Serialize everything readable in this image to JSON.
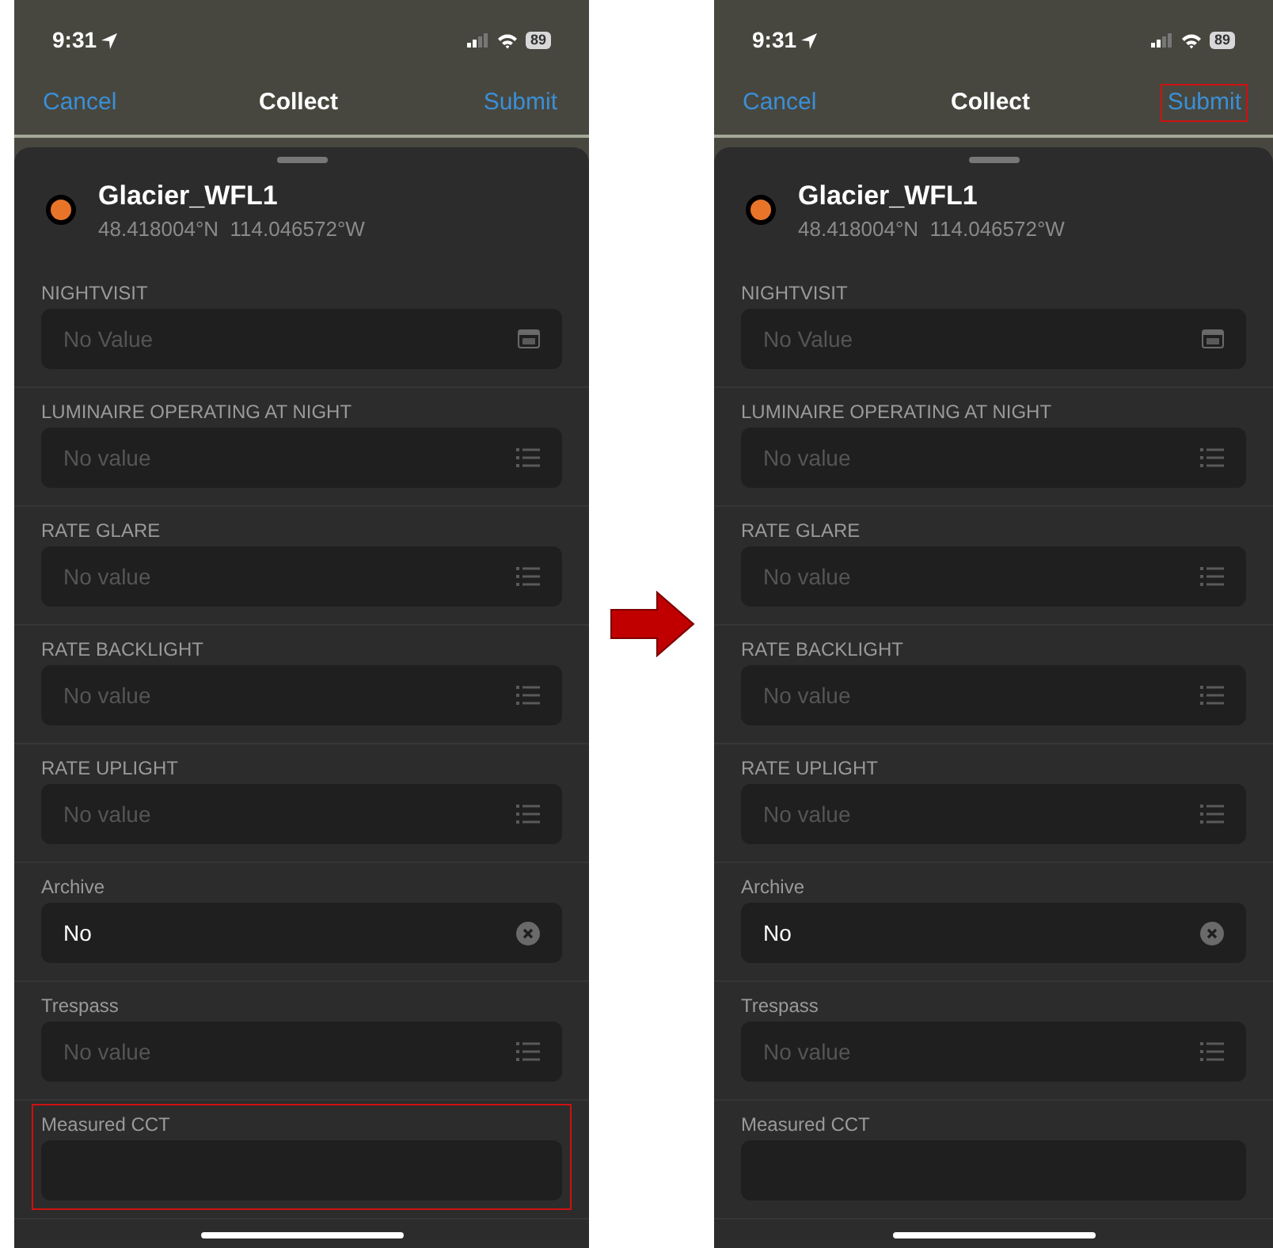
{
  "phones": [
    {
      "status": {
        "time": "9:31",
        "battery": "89"
      },
      "nav": {
        "cancel": "Cancel",
        "title": "Collect",
        "submit": "Submit",
        "submit_highlighted": false
      },
      "feature": {
        "name": "Glacier_WFL1",
        "coords": "48.418004°N  114.046572°W",
        "color": "#e8742a"
      },
      "fields": [
        {
          "label": "NIGHTVISIT",
          "kind": "date",
          "placeholder": "No Value",
          "highlighted": false
        },
        {
          "label": "LUMINAIRE OPERATING AT NIGHT",
          "kind": "list",
          "placeholder": "No value",
          "highlighted": false
        },
        {
          "label": "RATE GLARE",
          "kind": "list",
          "placeholder": "No value",
          "highlighted": false
        },
        {
          "label": "RATE BACKLIGHT",
          "kind": "list",
          "placeholder": "No value",
          "highlighted": false
        },
        {
          "label": "RATE UPLIGHT",
          "kind": "list",
          "placeholder": "No value",
          "highlighted": false
        },
        {
          "label": "Archive",
          "kind": "clear",
          "value": "No",
          "highlighted": false
        },
        {
          "label": "Trespass",
          "kind": "list",
          "placeholder": "No value",
          "highlighted": false
        },
        {
          "label": "Measured CCT",
          "kind": "text",
          "highlighted": true
        }
      ]
    },
    {
      "status": {
        "time": "9:31",
        "battery": "89"
      },
      "nav": {
        "cancel": "Cancel",
        "title": "Collect",
        "submit": "Submit",
        "submit_highlighted": true
      },
      "feature": {
        "name": "Glacier_WFL1",
        "coords": "48.418004°N  114.046572°W",
        "color": "#e8742a"
      },
      "fields": [
        {
          "label": "NIGHTVISIT",
          "kind": "date",
          "placeholder": "No Value",
          "highlighted": false
        },
        {
          "label": "LUMINAIRE OPERATING AT NIGHT",
          "kind": "list",
          "placeholder": "No value",
          "highlighted": false
        },
        {
          "label": "RATE GLARE",
          "kind": "list",
          "placeholder": "No value",
          "highlighted": false
        },
        {
          "label": "RATE BACKLIGHT",
          "kind": "list",
          "placeholder": "No value",
          "highlighted": false
        },
        {
          "label": "RATE UPLIGHT",
          "kind": "list",
          "placeholder": "No value",
          "highlighted": false
        },
        {
          "label": "Archive",
          "kind": "clear",
          "value": "No",
          "highlighted": false
        },
        {
          "label": "Trespass",
          "kind": "list",
          "placeholder": "No value",
          "highlighted": false
        },
        {
          "label": "Measured CCT",
          "kind": "text",
          "highlighted": false
        }
      ]
    }
  ]
}
